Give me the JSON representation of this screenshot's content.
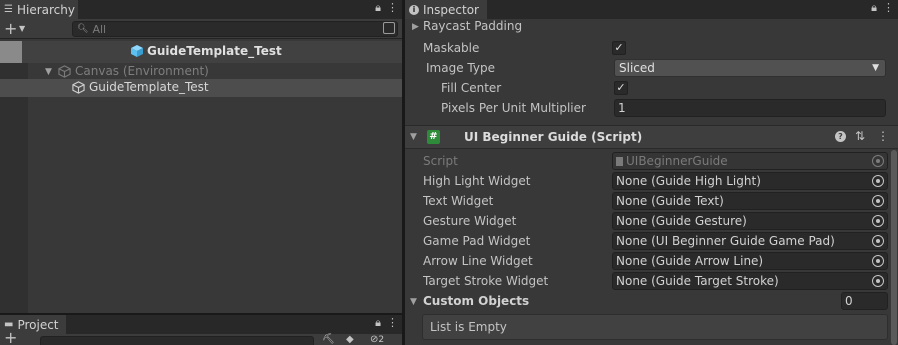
{
  "hierarchy": {
    "tab_label": "Hierarchy",
    "search_placeholder": "All",
    "scene_name": "GuideTemplate_Test",
    "items": [
      {
        "label": "Canvas (Environment)"
      },
      {
        "label": "GuideTemplate_Test"
      }
    ]
  },
  "project": {
    "tab_label": "Project",
    "badge_count": "2"
  },
  "inspector": {
    "tab_label": "Inspector",
    "image_section": {
      "raycast_padding_label": "Raycast Padding",
      "maskable_label": "Maskable",
      "maskable_checked": true,
      "image_type_label": "Image Type",
      "image_type_value": "Sliced",
      "fill_center_label": "Fill Center",
      "fill_center_checked": true,
      "ppu_label": "Pixels Per Unit Multiplier",
      "ppu_value": "1"
    },
    "component": {
      "title": "UI Beginner Guide (Script)",
      "script_label": "Script",
      "script_value": "UIBeginnerGuide",
      "fields": [
        {
          "label": "High Light Widget",
          "value": "None (Guide High Light)"
        },
        {
          "label": "Text Widget",
          "value": "None (Guide Text)"
        },
        {
          "label": "Gesture Widget",
          "value": "None (Guide Gesture)"
        },
        {
          "label": "Game Pad Widget",
          "value": "None (UI Beginner Guide Game Pad)"
        },
        {
          "label": "Arrow Line Widget",
          "value": "None (Guide Arrow Line)"
        },
        {
          "label": "Target Stroke Widget",
          "value": "None (Guide Target Stroke)"
        }
      ],
      "custom_objects_label": "Custom Objects",
      "custom_objects_count": "0",
      "list_empty_text": "List is Empty"
    }
  },
  "colors": {
    "panel": "#383838",
    "tabbar": "#282828",
    "selection": "#4d4d4d",
    "field": "#2a2a2a",
    "cube_icon": "#5cc0f0"
  }
}
